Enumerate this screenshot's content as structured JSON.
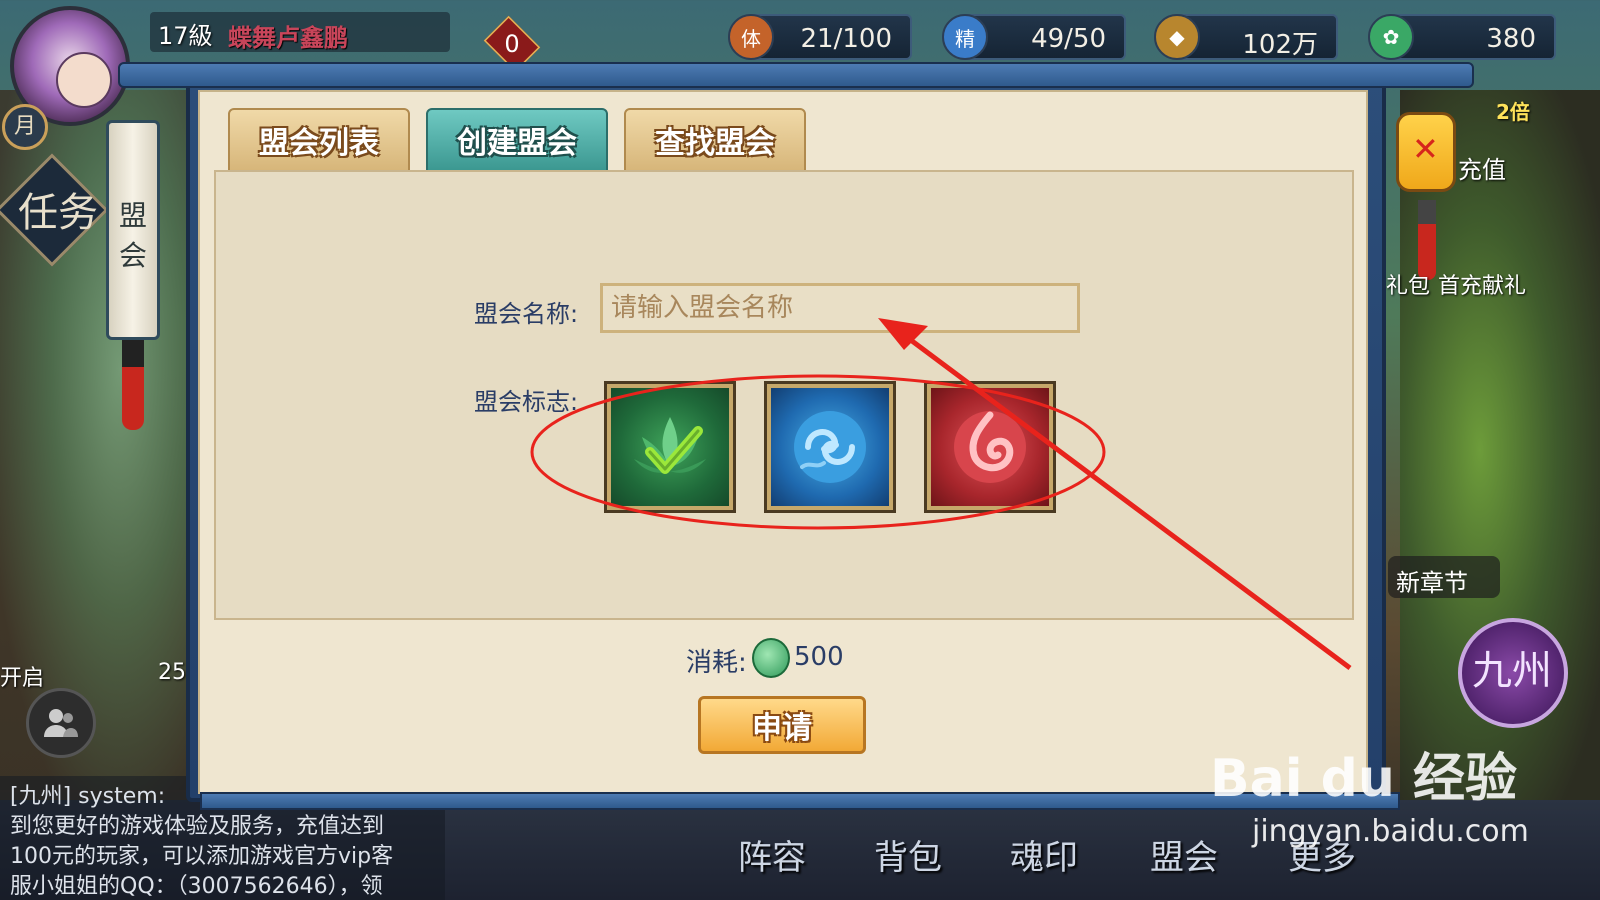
{
  "player": {
    "level": "17級",
    "name": "蝶舞卢鑫鹏",
    "red_badge_count": "0"
  },
  "resources": [
    {
      "icon": "stamina-icon",
      "value": "21/100",
      "color": "#c4632a"
    },
    {
      "icon": "energy-icon",
      "value": "49/50",
      "color": "#3a7cc9"
    },
    {
      "icon": "coin-icon",
      "value": "102万",
      "color": "#b8862e"
    },
    {
      "icon": "jade-icon",
      "value": "380",
      "color": "#3aa866"
    }
  ],
  "left_side": {
    "moon_badge": "月",
    "task_label": "任务",
    "banner_label": "盟会",
    "open_label": "开启",
    "count_25": "25"
  },
  "chat": {
    "lines": [
      "[九州] system:",
      "到您更好的游戏体验及服务，充值达到",
      "100元的玩家，可以添加游戏官方vip客",
      "服小姐姐的QQ：（3007562646），领"
    ]
  },
  "right_side": {
    "double_label": "2倍",
    "recharge_label": "充值",
    "gift_label": "礼包",
    "first_pay_label": "首充献礼",
    "new_chapter_label": "新章节",
    "jiuzhou_label": "九州"
  },
  "tabs": [
    {
      "label": "盟会列表",
      "active": false
    },
    {
      "label": "创建盟会",
      "active": true
    },
    {
      "label": "查找盟会",
      "active": false
    }
  ],
  "form": {
    "name_label": "盟会名称:",
    "name_placeholder": "请输入盟会名称",
    "emblem_label": "盟会标志:",
    "emblems": [
      {
        "name": "green-lotus-emblem",
        "color": "#2f8a4a",
        "selected": true
      },
      {
        "name": "blue-cloud-emblem",
        "color": "#2a7cc2",
        "selected": false
      },
      {
        "name": "red-flame-emblem",
        "color": "#b8303a",
        "selected": false
      }
    ],
    "cost_label": "消耗:",
    "cost_value": "500",
    "apply_label": "申请"
  },
  "bottom_nav": [
    "阵容",
    "背包",
    "魂印",
    "盟会",
    "更多"
  ],
  "watermark": {
    "main": "Bai du 经验",
    "sub": "jingyan.baidu.com"
  },
  "colors": {
    "frame_blue": "#2c4e7a",
    "paper": "#efe6d0",
    "tab_active": "#3c9891",
    "tab_inactive": "#d7b67a",
    "label_text": "#2a3d66",
    "annotation_red": "#e8231c"
  }
}
